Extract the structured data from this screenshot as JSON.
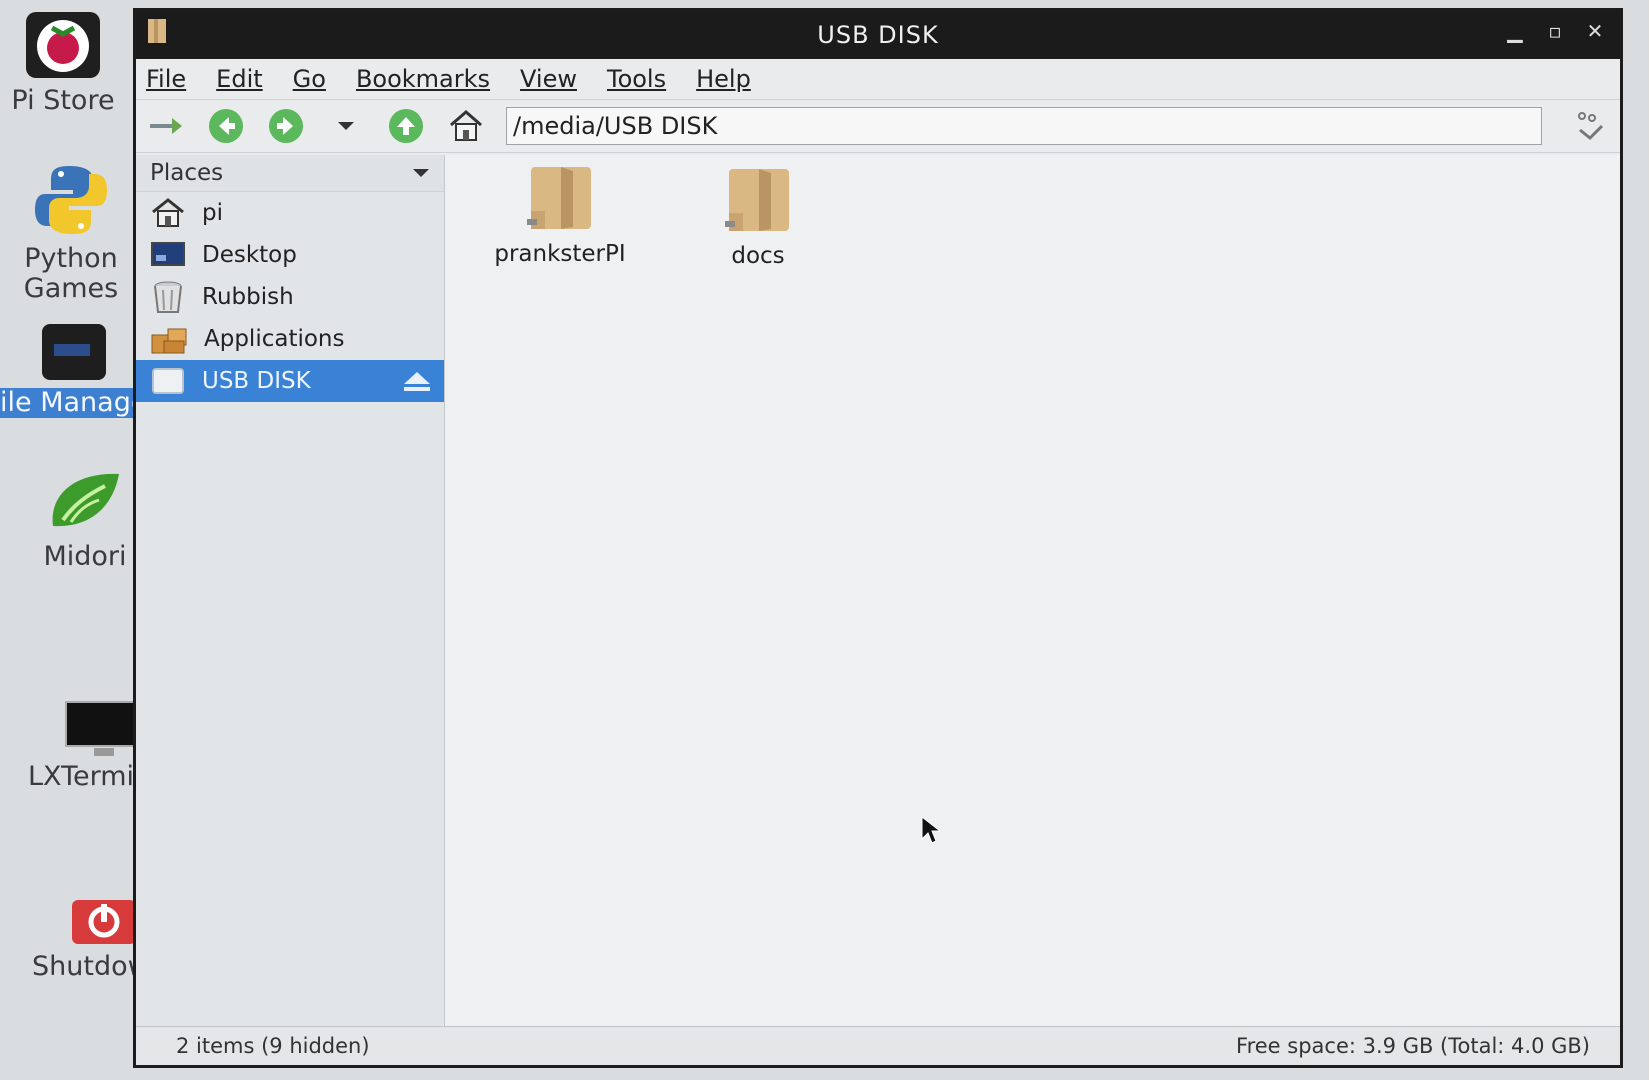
{
  "desktop": {
    "icons": [
      {
        "label": "Pi Store"
      },
      {
        "label": "Python Games"
      },
      {
        "label": "ile Manage"
      },
      {
        "label": "Midori"
      },
      {
        "label": "LXTermin"
      },
      {
        "label": "Shutdown"
      }
    ]
  },
  "window": {
    "title": "USB DISK",
    "menu": [
      "File",
      "Edit",
      "Go",
      "Bookmarks",
      "View",
      "Tools",
      "Help"
    ],
    "path": "/media/USB DISK",
    "places_header": "Places",
    "places": [
      {
        "label": "pi",
        "icon": "home-icon"
      },
      {
        "label": "Desktop",
        "icon": "desktop-icon"
      },
      {
        "label": "Rubbish",
        "icon": "trash-icon"
      },
      {
        "label": "Applications",
        "icon": "applications-icon"
      },
      {
        "label": "USB DISK",
        "icon": "drive-icon",
        "selected": true
      }
    ],
    "files": [
      {
        "name": "pranksterPI",
        "type": "folder"
      },
      {
        "name": "docs",
        "type": "folder"
      }
    ],
    "status_left": "2 items (9 hidden)",
    "status_right": "Free space: 3.9 GB (Total: 4.0 GB)"
  },
  "colors": {
    "selection": "#3a82d6",
    "titlebar": "#1b1b1b",
    "folder": "#d9b883"
  }
}
